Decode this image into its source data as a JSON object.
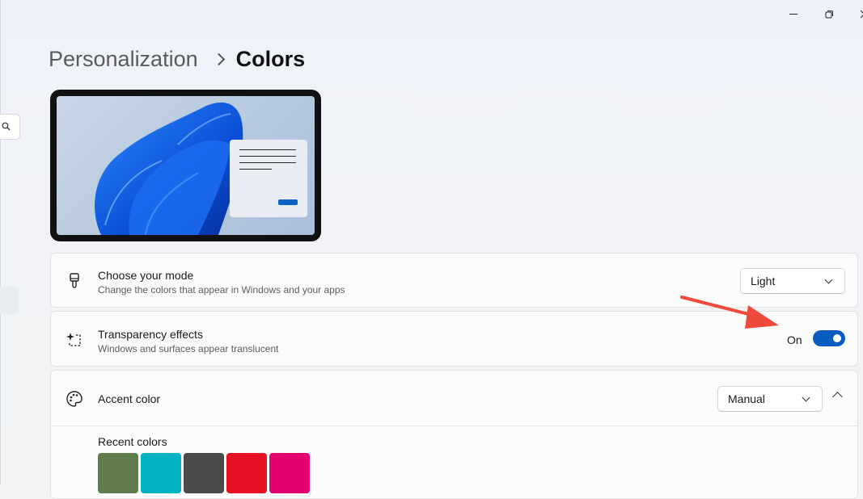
{
  "page": {
    "breadcrumb": {
      "parent": "Personalization",
      "current": "Colors"
    }
  },
  "settings": {
    "mode": {
      "title": "Choose your mode",
      "description": "Change the colors that appear in Windows and your apps",
      "value": "Light",
      "icon": "paint-brush-icon"
    },
    "transparency": {
      "title": "Transparency effects",
      "description": "Windows and surfaces appear translucent",
      "state_label": "On",
      "enabled": true,
      "icon": "transparency-sparkle-icon"
    },
    "accent": {
      "title": "Accent color",
      "value": "Manual",
      "icon": "palette-icon",
      "recent_label": "Recent colors",
      "recent_colors": [
        "#5f7c4a",
        "#00b3c2",
        "#4a4a4a",
        "#e81123",
        "#e3006f"
      ]
    }
  },
  "colors": {
    "accent": "#0b5cc1",
    "annotation_arrow": "#ef4a3c"
  }
}
